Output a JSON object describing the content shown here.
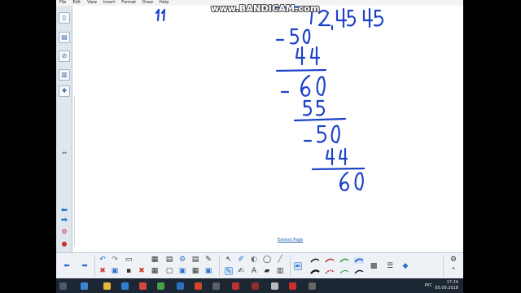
{
  "watermark": "www.BANDICAM.com",
  "menu": [
    "File",
    "Edit",
    "View",
    "Insert",
    "Format",
    "Draw",
    "Help"
  ],
  "canvas": {
    "extend_label": "Extend Page",
    "ink_color": "#1d43c8"
  },
  "taskbar": {
    "language": "РУС",
    "time": "17:24",
    "date": "05.09.2018"
  },
  "icons": {
    "side_tabs": [
      "page-sorter-icon",
      "gallery-icon",
      "attachments-icon",
      "properties-icon",
      "addons-icon"
    ],
    "toolbar": [
      "previous-page-icon",
      "next-page-icon",
      "undo-icon",
      "redo-icon",
      "delete-icon",
      "select-icon",
      "pen-icon",
      "highlighter-icon",
      "eraser-icon",
      "line-icon",
      "shapes-icon",
      "fill-icon",
      "text-icon",
      "table-icon",
      "settings-icon"
    ]
  }
}
